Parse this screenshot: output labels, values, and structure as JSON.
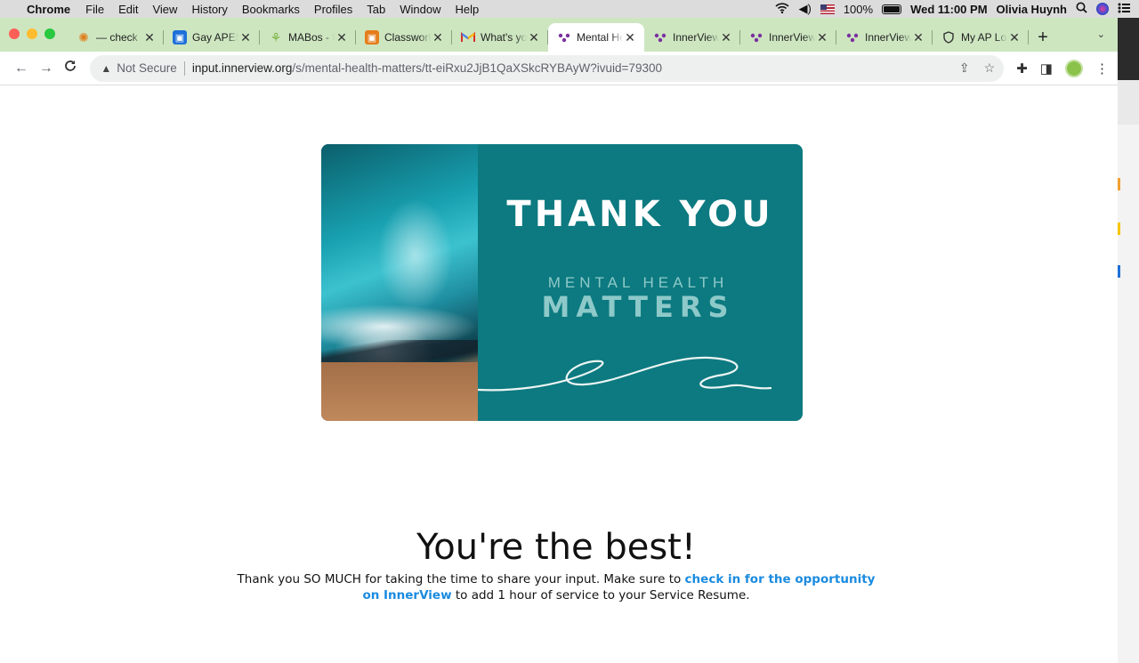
{
  "menubar": {
    "apple": "",
    "app": "Chrome",
    "items": [
      "File",
      "Edit",
      "View",
      "History",
      "Bookmarks",
      "Profiles",
      "Tab",
      "Window",
      "Help"
    ],
    "battery": "100%",
    "datetime": "Wed 11:00 PM",
    "user": "Olivia Huynh"
  },
  "tabs": [
    {
      "title": "— check",
      "icon": "orange-swirl-icon",
      "color": "#f0a030"
    },
    {
      "title": "Gay APES",
      "icon": "classroom-icon",
      "color": "#1e6fd9"
    },
    {
      "title": "MABos - I",
      "icon": "leaf-icon",
      "color": "#7cb342"
    },
    {
      "title": "Classwork",
      "icon": "classroom-icon",
      "color": "#e67c1b"
    },
    {
      "title": "What's yo",
      "icon": "gmail-icon",
      "color": "#ffffff"
    },
    {
      "title": "Mental He",
      "icon": "innerview-icon",
      "color": "#7b2fa0",
      "active": true
    },
    {
      "title": "InnerView",
      "icon": "innerview-icon",
      "color": "#7b2fa0"
    },
    {
      "title": "InnerView",
      "icon": "innerview-icon",
      "color": "#7b2fa0"
    },
    {
      "title": "InnerView",
      "icon": "innerview-icon",
      "color": "#7b2fa0"
    },
    {
      "title": "My AP Lo",
      "icon": "shield-icon",
      "color": "#333333"
    }
  ],
  "address": {
    "security": "Not Secure",
    "host": "input.innerview.org",
    "path": "/s/mental-health-matters/tt-eiRxu2JjB1QaXSkcRYBAyW?ivuid=79300"
  },
  "hero": {
    "headline": "THANK YOU",
    "line1": "MENTAL HEALTH",
    "line2": "MATTERS"
  },
  "page": {
    "heading": "You're the best!",
    "msg_before": "Thank you SO MUCH for taking the time to share your input. Make sure to ",
    "msg_link": "check in for the opportunity on InnerView",
    "msg_after": " to add 1 hour of service to your Service Resume."
  },
  "colors": {
    "tabstrip": "#cde6c0",
    "hero_teal": "#0c7a80",
    "link": "#1a8be0"
  }
}
